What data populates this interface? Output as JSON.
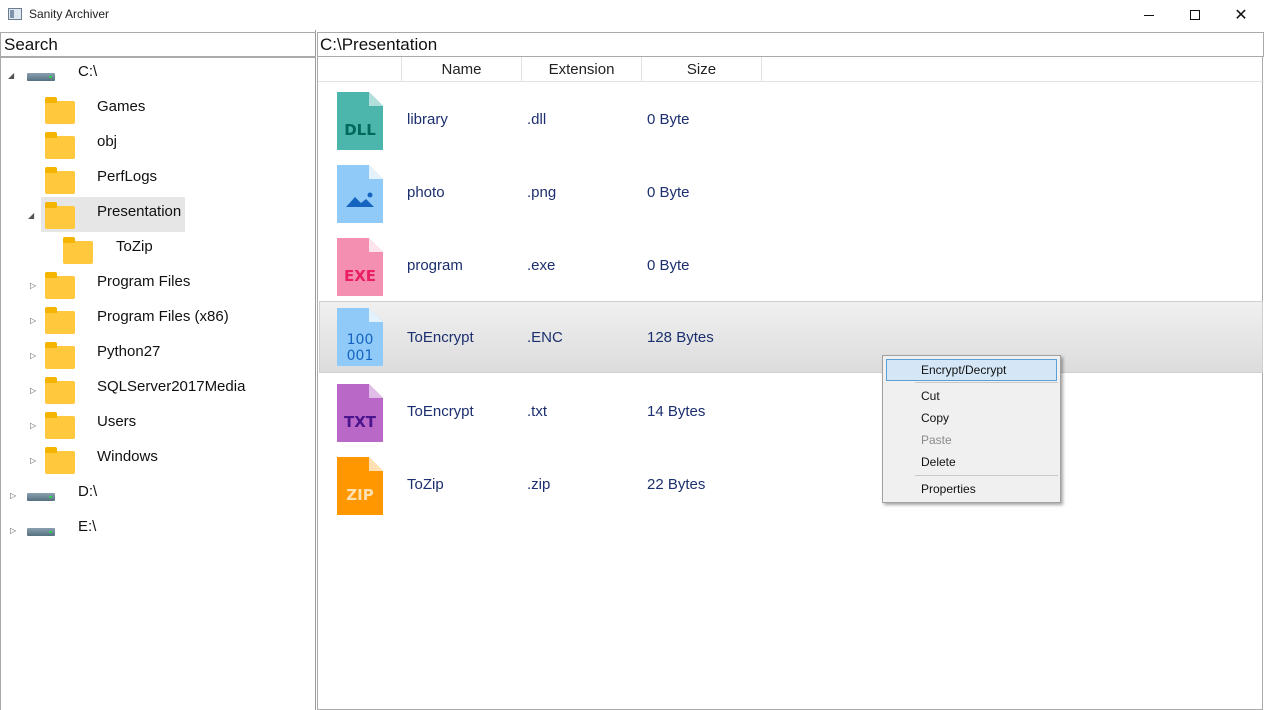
{
  "window": {
    "title": "Sanity Archiver"
  },
  "search": {
    "label": "Search"
  },
  "path": {
    "current": "C:\\Presentation"
  },
  "tree": {
    "drive_c": "C:\\",
    "folders": [
      "Games",
      "obj",
      "PerfLogs",
      "Presentation",
      "ToZip",
      "Program Files",
      "Program Files (x86)",
      "Python27",
      "SQLServer2017Media",
      "Users",
      "Windows"
    ],
    "drive_d": "D:\\",
    "drive_e": "E:\\"
  },
  "columns": {
    "name": "Name",
    "extension": "Extension",
    "size": "Size"
  },
  "files": [
    {
      "icon_text": "DLL",
      "name": "library",
      "ext": ".dll",
      "size": "0 Byte",
      "color": "#4db6ac"
    },
    {
      "icon_text": "",
      "name": "photo",
      "ext": ".png",
      "size": "0 Byte",
      "color": "#90caf9"
    },
    {
      "icon_text": "EXE",
      "name": "program",
      "ext": ".exe",
      "size": "0 Byte",
      "color": "#f48fb1"
    },
    {
      "icon_text": "100\n001",
      "name": "ToEncrypt",
      "ext": ".ENC",
      "size": "128 Bytes",
      "color": "#90caf9"
    },
    {
      "icon_text": "TXT",
      "name": "ToEncrypt",
      "ext": ".txt",
      "size": "14 Bytes",
      "color": "#ba68c8"
    },
    {
      "icon_text": "ZIP",
      "name": "ToZip",
      "ext": ".zip",
      "size": "22 Bytes",
      "color": "#ff9800"
    }
  ],
  "context_menu": {
    "encrypt": "Encrypt/Decrypt",
    "cut": "Cut",
    "copy": "Copy",
    "paste": "Paste",
    "delete": "Delete",
    "properties": "Properties"
  }
}
